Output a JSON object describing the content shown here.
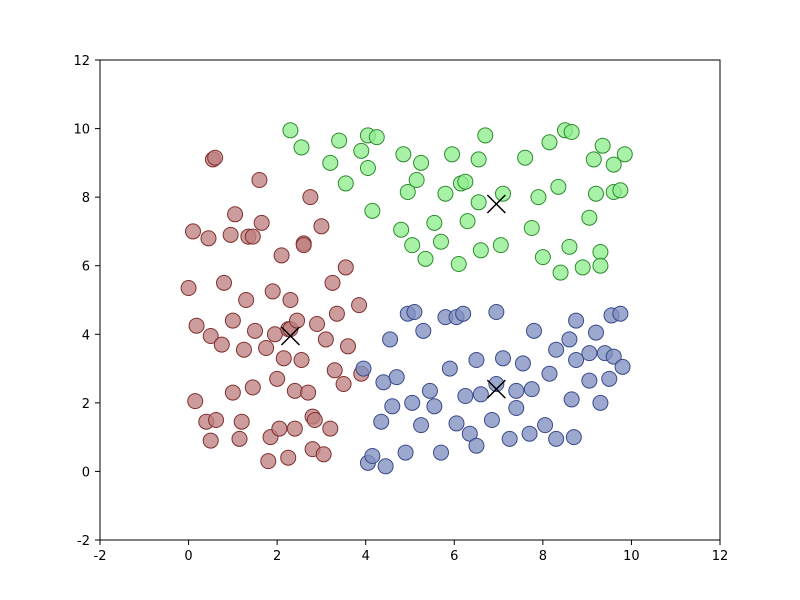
{
  "chart_data": {
    "type": "scatter",
    "title": "",
    "xlabel": "",
    "ylabel": "",
    "xlim": [
      -2,
      12
    ],
    "ylim": [
      -2,
      12
    ],
    "xticks": [
      -2,
      0,
      2,
      4,
      6,
      8,
      10,
      12
    ],
    "yticks": [
      -2,
      0,
      2,
      4,
      6,
      8,
      10,
      12
    ],
    "series": [
      {
        "name": "cluster-red",
        "color": "#bf8080",
        "edge": "#803030",
        "points": [
          [
            0.0,
            5.35
          ],
          [
            0.1,
            7.0
          ],
          [
            0.15,
            2.05
          ],
          [
            0.18,
            4.25
          ],
          [
            0.4,
            1.45
          ],
          [
            0.45,
            6.8
          ],
          [
            0.5,
            3.95
          ],
          [
            0.5,
            0.9
          ],
          [
            0.55,
            9.1
          ],
          [
            0.6,
            9.15
          ],
          [
            0.62,
            1.5
          ],
          [
            0.75,
            3.7
          ],
          [
            0.8,
            5.5
          ],
          [
            0.95,
            6.9
          ],
          [
            1.0,
            2.3
          ],
          [
            1.0,
            4.4
          ],
          [
            1.05,
            7.5
          ],
          [
            1.15,
            0.95
          ],
          [
            1.2,
            1.45
          ],
          [
            1.25,
            3.55
          ],
          [
            1.3,
            5.0
          ],
          [
            1.35,
            6.85
          ],
          [
            1.45,
            6.85
          ],
          [
            1.45,
            2.45
          ],
          [
            1.5,
            4.1
          ],
          [
            1.6,
            8.5
          ],
          [
            1.65,
            7.25
          ],
          [
            1.75,
            3.6
          ],
          [
            1.8,
            0.3
          ],
          [
            1.85,
            1.0
          ],
          [
            1.9,
            5.25
          ],
          [
            1.95,
            4.0
          ],
          [
            2.0,
            2.7
          ],
          [
            2.05,
            1.25
          ],
          [
            2.1,
            6.3
          ],
          [
            2.15,
            3.3
          ],
          [
            2.25,
            0.4
          ],
          [
            2.25,
            4.15
          ],
          [
            2.3,
            4.15
          ],
          [
            2.3,
            5.0
          ],
          [
            2.4,
            2.35
          ],
          [
            2.4,
            1.25
          ],
          [
            2.45,
            4.4
          ],
          [
            2.55,
            3.25
          ],
          [
            2.6,
            6.65
          ],
          [
            2.6,
            6.6
          ],
          [
            2.7,
            2.3
          ],
          [
            2.75,
            8.0
          ],
          [
            2.8,
            0.65
          ],
          [
            2.8,
            1.6
          ],
          [
            2.85,
            1.5
          ],
          [
            2.9,
            4.3
          ],
          [
            3.0,
            7.15
          ],
          [
            3.05,
            0.5
          ],
          [
            3.1,
            3.85
          ],
          [
            3.2,
            1.25
          ],
          [
            3.25,
            5.5
          ],
          [
            3.3,
            2.95
          ],
          [
            3.35,
            4.6
          ],
          [
            3.5,
            2.55
          ],
          [
            3.55,
            5.95
          ],
          [
            3.6,
            3.65
          ],
          [
            3.85,
            4.85
          ],
          [
            3.9,
            2.85
          ]
        ]
      },
      {
        "name": "cluster-green",
        "color": "#90ee90",
        "edge": "#2e8b2e",
        "points": [
          [
            2.3,
            9.95
          ],
          [
            2.55,
            9.45
          ],
          [
            3.2,
            9.0
          ],
          [
            3.4,
            9.65
          ],
          [
            3.55,
            8.4
          ],
          [
            3.9,
            9.35
          ],
          [
            4.05,
            8.85
          ],
          [
            4.05,
            9.8
          ],
          [
            4.15,
            7.6
          ],
          [
            4.25,
            9.75
          ],
          [
            4.8,
            7.05
          ],
          [
            4.85,
            9.25
          ],
          [
            4.95,
            8.15
          ],
          [
            5.05,
            6.6
          ],
          [
            5.15,
            8.5
          ],
          [
            5.25,
            9.0
          ],
          [
            5.35,
            6.2
          ],
          [
            5.55,
            7.25
          ],
          [
            5.7,
            6.7
          ],
          [
            5.8,
            8.1
          ],
          [
            5.95,
            9.25
          ],
          [
            6.1,
            6.05
          ],
          [
            6.15,
            8.4
          ],
          [
            6.25,
            8.45
          ],
          [
            6.3,
            7.3
          ],
          [
            6.55,
            9.1
          ],
          [
            6.6,
            6.45
          ],
          [
            6.55,
            7.85
          ],
          [
            6.7,
            9.8
          ],
          [
            7.05,
            6.6
          ],
          [
            7.1,
            8.1
          ],
          [
            7.6,
            9.15
          ],
          [
            7.75,
            7.1
          ],
          [
            7.9,
            8.0
          ],
          [
            8.0,
            6.25
          ],
          [
            8.15,
            9.6
          ],
          [
            8.35,
            8.3
          ],
          [
            8.4,
            5.8
          ],
          [
            8.5,
            9.95
          ],
          [
            8.6,
            6.55
          ],
          [
            8.65,
            9.9
          ],
          [
            8.9,
            5.95
          ],
          [
            9.05,
            7.4
          ],
          [
            9.15,
            9.1
          ],
          [
            9.2,
            8.1
          ],
          [
            9.3,
            6.4
          ],
          [
            9.3,
            6.0
          ],
          [
            9.35,
            9.5
          ],
          [
            9.6,
            8.15
          ],
          [
            9.6,
            8.95
          ],
          [
            9.75,
            8.2
          ],
          [
            9.85,
            9.25
          ]
        ]
      },
      {
        "name": "cluster-blue",
        "color": "#8090c0",
        "edge": "#3a4a8a",
        "points": [
          [
            3.95,
            3.0
          ],
          [
            4.05,
            0.25
          ],
          [
            4.15,
            0.45
          ],
          [
            4.35,
            1.45
          ],
          [
            4.4,
            2.6
          ],
          [
            4.45,
            0.15
          ],
          [
            4.55,
            3.85
          ],
          [
            4.6,
            1.9
          ],
          [
            4.7,
            2.75
          ],
          [
            4.9,
            0.55
          ],
          [
            4.95,
            4.6
          ],
          [
            5.05,
            2.0
          ],
          [
            5.1,
            4.65
          ],
          [
            5.25,
            1.35
          ],
          [
            5.3,
            4.1
          ],
          [
            5.45,
            2.35
          ],
          [
            5.55,
            1.9
          ],
          [
            5.7,
            0.55
          ],
          [
            5.8,
            4.5
          ],
          [
            5.9,
            3.0
          ],
          [
            6.05,
            1.4
          ],
          [
            6.05,
            4.5
          ],
          [
            6.2,
            4.6
          ],
          [
            6.25,
            2.2
          ],
          [
            6.35,
            1.1
          ],
          [
            6.5,
            0.75
          ],
          [
            6.5,
            3.25
          ],
          [
            6.6,
            2.25
          ],
          [
            6.85,
            1.5
          ],
          [
            6.95,
            4.65
          ],
          [
            6.95,
            2.55
          ],
          [
            7.1,
            3.3
          ],
          [
            7.25,
            0.95
          ],
          [
            7.4,
            2.35
          ],
          [
            7.4,
            1.85
          ],
          [
            7.55,
            3.15
          ],
          [
            7.7,
            1.1
          ],
          [
            7.75,
            2.4
          ],
          [
            7.8,
            4.1
          ],
          [
            8.05,
            1.35
          ],
          [
            8.15,
            2.85
          ],
          [
            8.3,
            0.95
          ],
          [
            8.3,
            3.55
          ],
          [
            8.6,
            3.85
          ],
          [
            8.65,
            2.1
          ],
          [
            8.7,
            1.0
          ],
          [
            8.75,
            3.25
          ],
          [
            8.75,
            4.4
          ],
          [
            9.05,
            2.65
          ],
          [
            9.05,
            3.45
          ],
          [
            9.2,
            4.05
          ],
          [
            9.3,
            2.0
          ],
          [
            9.4,
            3.45
          ],
          [
            9.5,
            2.7
          ],
          [
            9.55,
            4.55
          ],
          [
            9.6,
            3.35
          ],
          [
            9.75,
            4.6
          ],
          [
            9.8,
            3.05
          ]
        ]
      },
      {
        "name": "centroids",
        "marker": "x",
        "color": "#000000",
        "points": [
          [
            2.3,
            3.95
          ],
          [
            6.95,
            7.8
          ],
          [
            6.95,
            2.4
          ]
        ]
      }
    ]
  },
  "tick_labels": {
    "x": [
      "-2",
      "0",
      "2",
      "4",
      "6",
      "8",
      "10",
      "12"
    ],
    "y": [
      "-2",
      "0",
      "2",
      "4",
      "6",
      "8",
      "10",
      "12"
    ]
  }
}
